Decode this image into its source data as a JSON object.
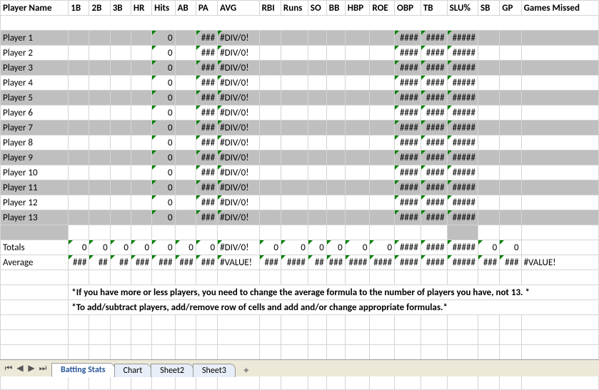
{
  "headers": [
    "Player Name",
    "1B",
    "2B",
    "3B",
    "HR",
    "Hits",
    "AB",
    "PA",
    "AVG",
    "RBI",
    "Runs",
    "SO",
    "BB",
    "HBP",
    "ROE",
    "OBP",
    "TB",
    "SLU%",
    "SB",
    "GP",
    "Games Missed"
  ],
  "players": [
    {
      "name": "Player 1",
      "hits": "0",
      "pa": "###",
      "avg": "#DIV/0!",
      "obp": "####",
      "tb": "####",
      "slu": "#####"
    },
    {
      "name": "Player 2",
      "hits": "0",
      "pa": "###",
      "avg": "#DIV/0!",
      "obp": "####",
      "tb": "####",
      "slu": "#####"
    },
    {
      "name": "Player 3",
      "hits": "0",
      "pa": "###",
      "avg": "#DIV/0!",
      "obp": "####",
      "tb": "####",
      "slu": "#####"
    },
    {
      "name": "Player 4",
      "hits": "0",
      "pa": "###",
      "avg": "#DIV/0!",
      "obp": "####",
      "tb": "####",
      "slu": "#####"
    },
    {
      "name": "Player 5",
      "hits": "0",
      "pa": "###",
      "avg": "#DIV/0!",
      "obp": "####",
      "tb": "####",
      "slu": "#####"
    },
    {
      "name": "Player 6",
      "hits": "0",
      "pa": "###",
      "avg": "#DIV/0!",
      "obp": "####",
      "tb": "####",
      "slu": "#####"
    },
    {
      "name": "Player 7",
      "hits": "0",
      "pa": "###",
      "avg": "#DIV/0!",
      "obp": "####",
      "tb": "####",
      "slu": "#####"
    },
    {
      "name": "Player 8",
      "hits": "0",
      "pa": "###",
      "avg": "#DIV/0!",
      "obp": "####",
      "tb": "####",
      "slu": "#####"
    },
    {
      "name": "Player 9",
      "hits": "0",
      "pa": "###",
      "avg": "#DIV/0!",
      "obp": "####",
      "tb": "####",
      "slu": "#####"
    },
    {
      "name": "Player 10",
      "hits": "0",
      "pa": "###",
      "avg": "#DIV/0!",
      "obp": "####",
      "tb": "####",
      "slu": "#####"
    },
    {
      "name": "Player 11",
      "hits": "0",
      "pa": "###",
      "avg": "#DIV/0!",
      "obp": "####",
      "tb": "####",
      "slu": "#####"
    },
    {
      "name": "Player 12",
      "hits": "0",
      "pa": "###",
      "avg": "#DIV/0!",
      "obp": "####",
      "tb": "####",
      "slu": "#####"
    },
    {
      "name": "Player 13",
      "hits": "0",
      "pa": "###",
      "avg": "#DIV/0!",
      "obp": "####",
      "tb": "####",
      "slu": "#####"
    }
  ],
  "totals": {
    "label": "Totals",
    "b1": "0",
    "b2": "0",
    "b3": "0",
    "hr": "0",
    "hits": "0",
    "ab": "0",
    "pa": "0",
    "avg": "#DIV/0!",
    "rbi": "0",
    "runs": "0",
    "so": "0",
    "bb": "0",
    "hbp": "0",
    "roe": "0",
    "obp": "####",
    "tb": "####",
    "slu": "#####",
    "sb": "0",
    "gp": "0"
  },
  "average": {
    "label": "Average",
    "b1": "###",
    "b2": "##",
    "b3": "##",
    "hr": "###",
    "hits": "###",
    "ab": "###",
    "pa": "###",
    "avg": "#VALUE!",
    "rbi": "###",
    "runs": "####",
    "so": "##",
    "bb": "###",
    "hbp": "####",
    "roe": "####",
    "obp": "####",
    "tb": "####",
    "slu": "#####",
    "sb": "###",
    "gp": "###",
    "gm": "#VALUE!"
  },
  "notes": {
    "line1": "*If you have more or less players, you need to change the average formula to the number of players you have, not 13. *",
    "line2": "*To add/subtract players, add/remove row of cells and add and/or change appropriate formulas.*"
  },
  "tabs": {
    "active": "Batting Stats",
    "others": [
      "Chart",
      "Sheet2",
      "Sheet3"
    ]
  }
}
